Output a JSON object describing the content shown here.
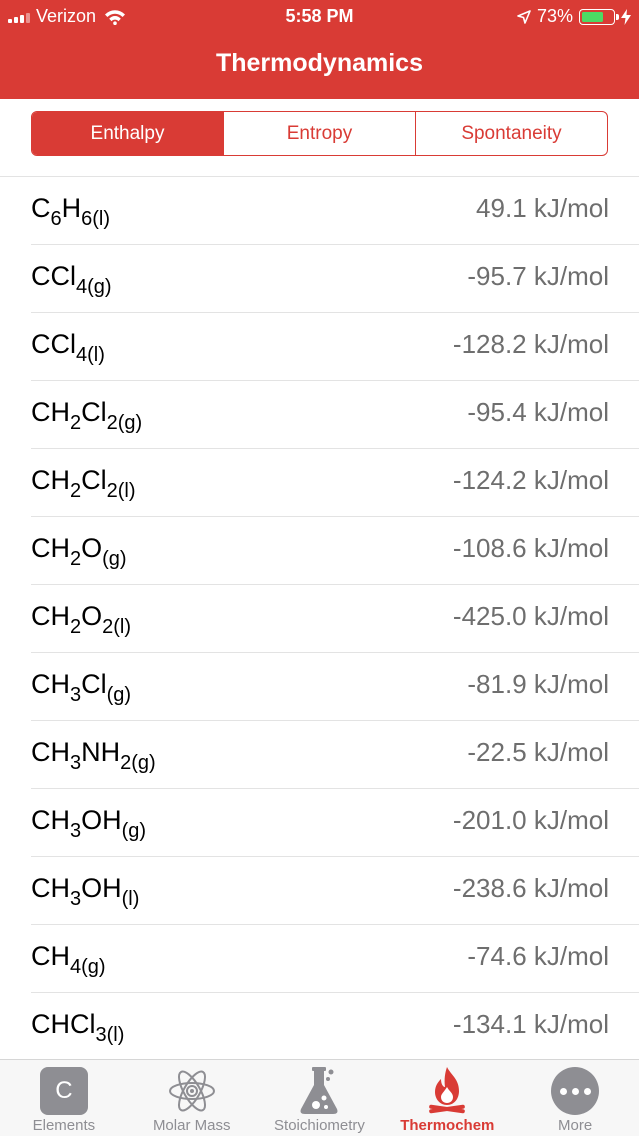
{
  "status_bar": {
    "carrier": "Verizon",
    "time": "5:58 PM",
    "battery_percent": "73%",
    "battery_level": 0.73
  },
  "nav": {
    "title": "Thermodynamics"
  },
  "segments": [
    {
      "label": "Enthalpy",
      "active": true
    },
    {
      "label": "Entropy",
      "active": false
    },
    {
      "label": "Spontaneity",
      "active": false
    }
  ],
  "rows": [
    {
      "formula": [
        {
          "t": "C"
        },
        {
          "s": "6"
        },
        {
          "t": "H"
        },
        {
          "s": "6(l)"
        }
      ],
      "value": "49.1 kJ/mol"
    },
    {
      "formula": [
        {
          "t": "CCl"
        },
        {
          "s": "4(g)"
        }
      ],
      "value": "-95.7 kJ/mol"
    },
    {
      "formula": [
        {
          "t": "CCl"
        },
        {
          "s": "4(l)"
        }
      ],
      "value": "-128.2 kJ/mol"
    },
    {
      "formula": [
        {
          "t": "CH"
        },
        {
          "s": "2"
        },
        {
          "t": "Cl"
        },
        {
          "s": "2(g)"
        }
      ],
      "value": "-95.4 kJ/mol"
    },
    {
      "formula": [
        {
          "t": "CH"
        },
        {
          "s": "2"
        },
        {
          "t": "Cl"
        },
        {
          "s": "2(l)"
        }
      ],
      "value": "-124.2 kJ/mol"
    },
    {
      "formula": [
        {
          "t": "CH"
        },
        {
          "s": "2"
        },
        {
          "t": "O"
        },
        {
          "s": "(g)"
        }
      ],
      "value": "-108.6 kJ/mol"
    },
    {
      "formula": [
        {
          "t": "CH"
        },
        {
          "s": "2"
        },
        {
          "t": "O"
        },
        {
          "s": "2(l)"
        }
      ],
      "value": "-425.0 kJ/mol"
    },
    {
      "formula": [
        {
          "t": "CH"
        },
        {
          "s": "3"
        },
        {
          "t": "Cl"
        },
        {
          "s": "(g)"
        }
      ],
      "value": "-81.9 kJ/mol"
    },
    {
      "formula": [
        {
          "t": "CH"
        },
        {
          "s": "3"
        },
        {
          "t": "NH"
        },
        {
          "s": "2(g)"
        }
      ],
      "value": "-22.5 kJ/mol"
    },
    {
      "formula": [
        {
          "t": "CH"
        },
        {
          "s": "3"
        },
        {
          "t": "OH"
        },
        {
          "s": "(g)"
        }
      ],
      "value": "-201.0 kJ/mol"
    },
    {
      "formula": [
        {
          "t": "CH"
        },
        {
          "s": "3"
        },
        {
          "t": "OH"
        },
        {
          "s": "(l)"
        }
      ],
      "value": "-238.6 kJ/mol"
    },
    {
      "formula": [
        {
          "t": "CH"
        },
        {
          "s": "4(g)"
        }
      ],
      "value": "-74.6 kJ/mol"
    },
    {
      "formula": [
        {
          "t": "CHCl"
        },
        {
          "s": "3(l)"
        }
      ],
      "value": "-134.1 kJ/mol"
    }
  ],
  "tabs": [
    {
      "label": "Elements",
      "icon": "elements-icon",
      "glyph": "C",
      "active": false
    },
    {
      "label": "Molar Mass",
      "icon": "atom-icon",
      "active": false
    },
    {
      "label": "Stoichiometry",
      "icon": "flask-icon",
      "active": false
    },
    {
      "label": "Thermochem",
      "icon": "flame-icon",
      "active": true
    },
    {
      "label": "More",
      "icon": "more-icon",
      "active": false
    }
  ],
  "colors": {
    "accent": "#d93b35",
    "battery_fill": "#4cd964",
    "inactive_tab": "#8e8e93",
    "value_text": "#6e6e6e"
  }
}
